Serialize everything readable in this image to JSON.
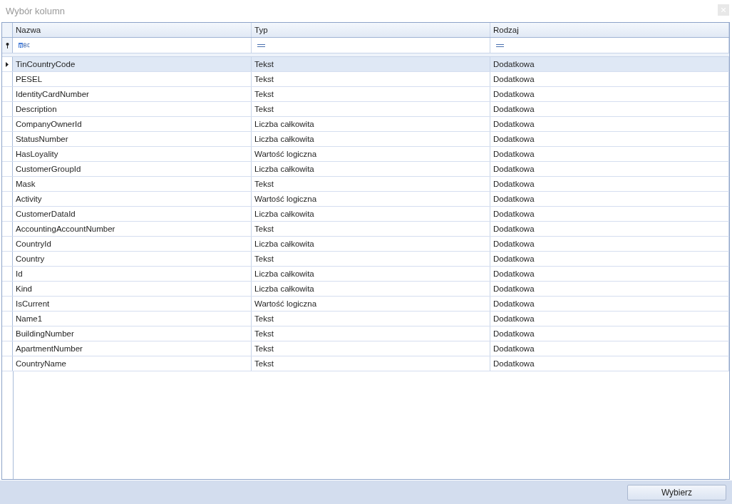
{
  "window": {
    "title": "Wybór kolumn"
  },
  "table": {
    "columns": [
      "Nazwa",
      "Typ",
      "Rodzaj"
    ],
    "rows": [
      {
        "name": "TinCountryCode",
        "type": "Tekst",
        "category": "Dodatkowa",
        "selected": true
      },
      {
        "name": "PESEL",
        "type": "Tekst",
        "category": "Dodatkowa",
        "selected": false
      },
      {
        "name": "IdentityCardNumber",
        "type": "Tekst",
        "category": "Dodatkowa",
        "selected": false
      },
      {
        "name": "Description",
        "type": "Tekst",
        "category": "Dodatkowa",
        "selected": false
      },
      {
        "name": "CompanyOwnerId",
        "type": "Liczba całkowita",
        "category": "Dodatkowa",
        "selected": false
      },
      {
        "name": "StatusNumber",
        "type": "Liczba całkowita",
        "category": "Dodatkowa",
        "selected": false
      },
      {
        "name": "HasLoyality",
        "type": "Wartość logiczna",
        "category": "Dodatkowa",
        "selected": false
      },
      {
        "name": "CustomerGroupId",
        "type": "Liczba całkowita",
        "category": "Dodatkowa",
        "selected": false
      },
      {
        "name": "Mask",
        "type": "Tekst",
        "category": "Dodatkowa",
        "selected": false
      },
      {
        "name": "Activity",
        "type": "Wartość logiczna",
        "category": "Dodatkowa",
        "selected": false
      },
      {
        "name": "CustomerDataId",
        "type": "Liczba całkowita",
        "category": "Dodatkowa",
        "selected": false
      },
      {
        "name": "AccountingAccountNumber",
        "type": "Tekst",
        "category": "Dodatkowa",
        "selected": false
      },
      {
        "name": "CountryId",
        "type": "Liczba całkowita",
        "category": "Dodatkowa",
        "selected": false
      },
      {
        "name": "Country",
        "type": "Tekst",
        "category": "Dodatkowa",
        "selected": false
      },
      {
        "name": "Id",
        "type": "Liczba całkowita",
        "category": "Dodatkowa",
        "selected": false
      },
      {
        "name": "Kind",
        "type": "Liczba całkowita",
        "category": "Dodatkowa",
        "selected": false
      },
      {
        "name": "IsCurrent",
        "type": "Wartość logiczna",
        "category": "Dodatkowa",
        "selected": false
      },
      {
        "name": "Name1",
        "type": "Tekst",
        "category": "Dodatkowa",
        "selected": false
      },
      {
        "name": "BuildingNumber",
        "type": "Tekst",
        "category": "Dodatkowa",
        "selected": false
      },
      {
        "name": "ApartmentNumber",
        "type": "Tekst",
        "category": "Dodatkowa",
        "selected": false
      },
      {
        "name": "CountryName",
        "type": "Tekst",
        "category": "Dodatkowa",
        "selected": false
      }
    ]
  },
  "buttons": [
    "Wybierz"
  ]
}
